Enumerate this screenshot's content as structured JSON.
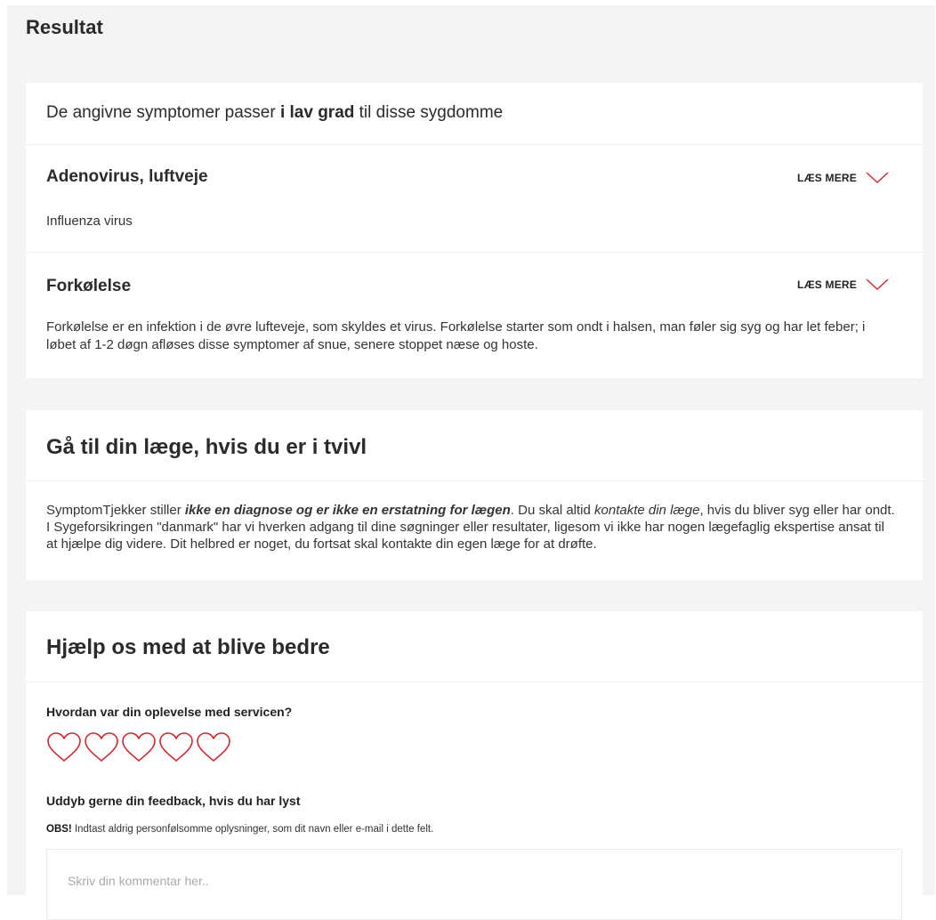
{
  "result": {
    "title": "Resultat"
  },
  "match": {
    "intro_before": "De angivne symptomer passer ",
    "intro_bold": "i lav grad",
    "intro_after": " til disse sygdomme",
    "read_more_label": "LÆS MERE",
    "accent_color": "#d9252b",
    "diseases": [
      {
        "name": "Adenovirus, luftveje",
        "description": "Influenza virus"
      },
      {
        "name": "Forkølelse",
        "description": "Forkølelse er en infektion i de øvre lufteveje, som skyldes et virus. Forkølelse starter som ondt i halsen, man føler sig syg og har let feber; i løbet af 1-2 døgn afløses disse symptomer af snue, senere stoppet næse og hoste."
      }
    ]
  },
  "doctor": {
    "title": "Gå til din læge, hvis du er i tvivl",
    "p1": "SymptomTjekker stiller ",
    "p2_bold_italic": "ikke en diagnose og er ikke en erstatning for lægen",
    "p3": ". Du skal altid ",
    "p4_italic": "kontakte din læge",
    "p5": ", hvis du bliver syg eller har ondt. I Sygeforsikringen \"danmark\" har vi hverken adgang til dine søgninger eller resultater, ligesom vi ikke har nogen lægefaglig ekspertise ansat til at hjælpe dig videre. Dit helbred er noget, du fortsat skal kontakte din egen læge for at drøfte."
  },
  "feedback": {
    "title": "Hjælp os med at blive bedre",
    "rating_question": "Hvordan var din oplevelse med servicen?",
    "rating": 0,
    "rating_max": 5,
    "heart_icon": "heart-outline-icon",
    "details_label": "Uddyb gerne din feedback, hvis du har lyst",
    "obs_bold": "OBS!",
    "obs_text": " Indtast aldrig personfølsomme oplysninger, som dit navn eller e-mail i dette felt.",
    "comment_placeholder": "Skriv din kommentar her.."
  }
}
